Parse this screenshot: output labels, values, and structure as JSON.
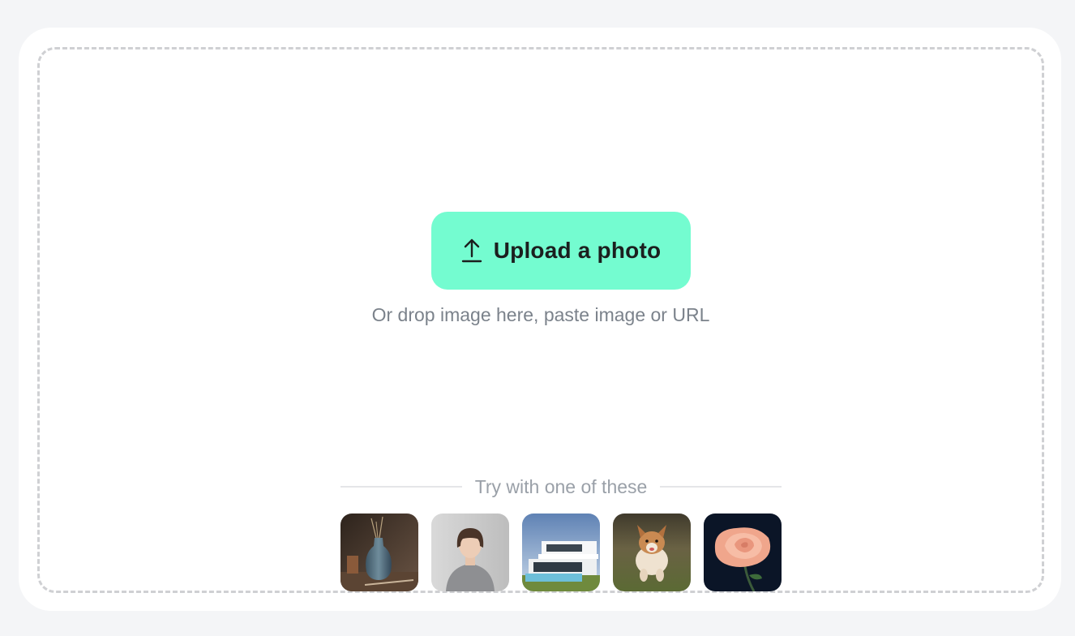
{
  "upload": {
    "button_label": "Upload a photo",
    "icon": "upload-arrow-icon",
    "hint": "Or drop image here, paste image or URL"
  },
  "samples": {
    "title": "Try with one of these",
    "items": [
      {
        "name": "vase-thumbnail"
      },
      {
        "name": "woman-portrait-thumbnail"
      },
      {
        "name": "modern-house-thumbnail"
      },
      {
        "name": "running-dog-thumbnail"
      },
      {
        "name": "rose-thumbnail"
      }
    ]
  },
  "colors": {
    "accent": "#74fcd0",
    "page_background": "#f4f5f7",
    "card_background": "#ffffff",
    "dashed_border": "#cfd0d3",
    "hint_text": "#7b828b"
  }
}
